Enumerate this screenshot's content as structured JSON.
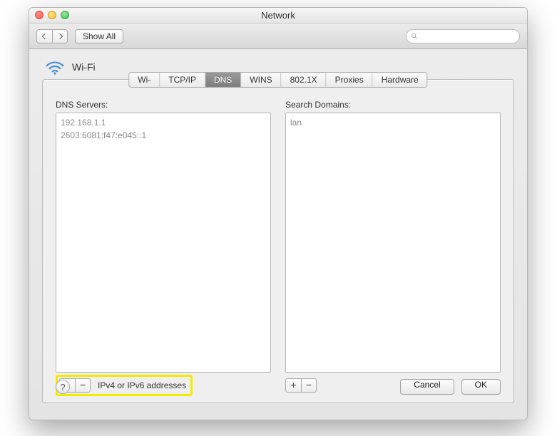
{
  "window": {
    "title": "Network"
  },
  "toolbar": {
    "show_all": "Show All",
    "search_placeholder": ""
  },
  "header": {
    "connection_name": "Wi-Fi"
  },
  "tabs": {
    "items": [
      {
        "label": "Wi-Fi"
      },
      {
        "label": "TCP/IP"
      },
      {
        "label": "DNS"
      },
      {
        "label": "WINS"
      },
      {
        "label": "802.1X"
      },
      {
        "label": "Proxies"
      },
      {
        "label": "Hardware"
      }
    ],
    "active_index": 2
  },
  "dns": {
    "servers_label": "DNS Servers:",
    "servers": [
      "192.168.1.1",
      "2603:6081:f47:e045::1"
    ],
    "add_hint": "IPv4 or IPv6 addresses"
  },
  "search_domains": {
    "label": "Search Domains:",
    "items": [
      "lan"
    ]
  },
  "buttons": {
    "plus": "+",
    "minus": "−",
    "help": "?",
    "cancel": "Cancel",
    "ok": "OK"
  }
}
